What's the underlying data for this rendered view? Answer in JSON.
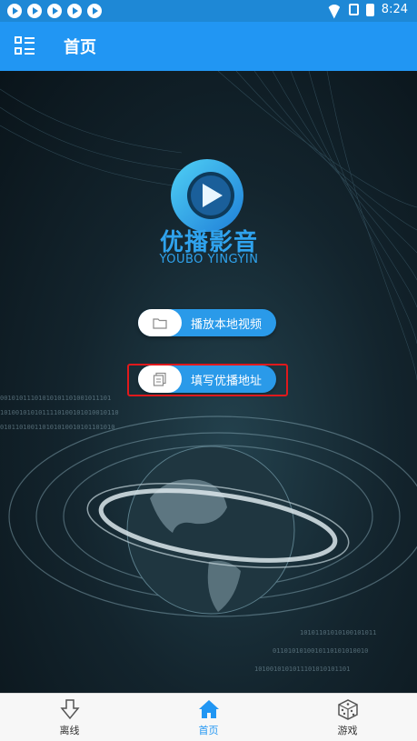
{
  "status_bar": {
    "time": "8:24",
    "notification_icons": [
      "play-circle-icon",
      "play-circle-icon",
      "play-circle-icon",
      "play-circle-icon",
      "play-circle-icon"
    ]
  },
  "app_bar": {
    "title": "首页"
  },
  "brand": {
    "name_cn": "优播影音",
    "name_en": "YOUBO YINGYIN"
  },
  "actions": {
    "play_local": "播放本地视频",
    "enter_address": "填写优播地址"
  },
  "tabs": [
    {
      "label": "离线",
      "icon": "download-arrow-icon",
      "active": false
    },
    {
      "label": "首页",
      "icon": "home-icon",
      "active": true
    },
    {
      "label": "游戏",
      "icon": "dice-icon",
      "active": false
    }
  ],
  "colors": {
    "primary": "#2196f3",
    "highlight_border": "#e0191c"
  }
}
